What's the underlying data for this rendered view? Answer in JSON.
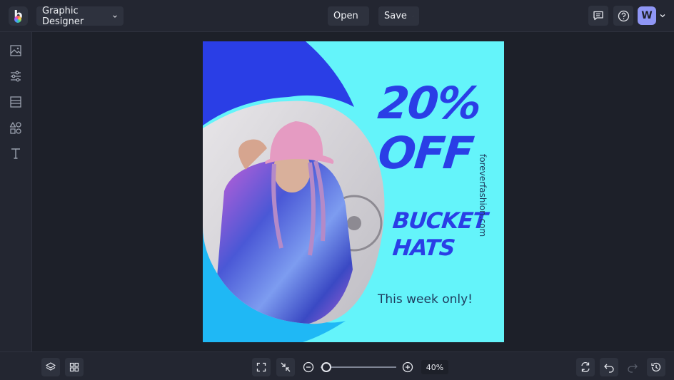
{
  "app": {
    "mode_label": "Graphic Designer",
    "open_label": "Open",
    "save_label": "Save",
    "user_initial": "W"
  },
  "icons": {
    "logo": "befunky-logo-icon",
    "comment": "comment-icon",
    "help": "help-icon",
    "sidebar": [
      "image-icon",
      "sliders-icon",
      "layout-icon",
      "shapes-icon",
      "text-icon"
    ],
    "bottom_left": [
      "layers-icon",
      "grid-icon"
    ],
    "bottom_center": [
      "fit-screen-icon",
      "shrink-icon",
      "zoom-out-icon",
      "zoom-in-icon"
    ],
    "bottom_right": [
      "replace-icon",
      "undo-icon",
      "redo-icon",
      "history-icon"
    ]
  },
  "design": {
    "headline_1": "20%",
    "headline_2": "OFF",
    "subhead_1": "BUCKET",
    "subhead_2": "HATS",
    "tagline": "This week only!",
    "website": "foreverfashion.com",
    "colors": {
      "background": "#64f4fa",
      "blob_dark": "#2a3ee6",
      "blob_light": "#1fb8f5",
      "text_primary": "#2a3ee6",
      "text_secondary": "#1e3a5c"
    }
  },
  "zoom": {
    "value_label": "40%",
    "level": 0.08
  },
  "theme": {
    "bg": "#1d2029",
    "panel": "#232631",
    "button": "#2e323e",
    "avatar": "#8f96f5"
  }
}
